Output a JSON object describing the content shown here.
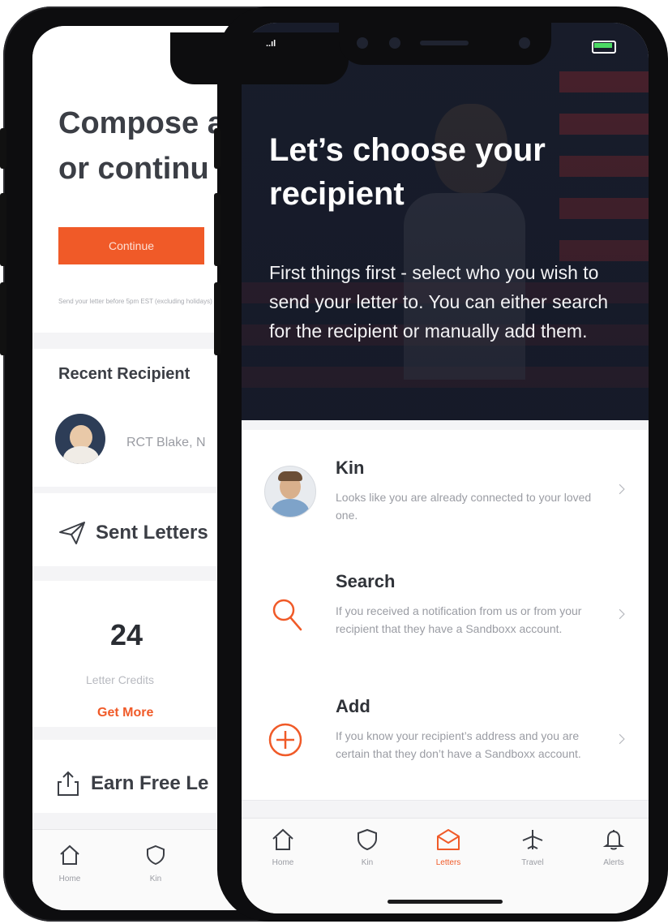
{
  "back_screen": {
    "compose_title_line1": "Compose a",
    "compose_title_line2": "or continu",
    "continue_label": "Continue",
    "note": "Send your letter before 5pm EST (excluding holidays)",
    "recent_recipients_title": "Recent Recipient",
    "recent_recipient_name": "RCT Blake, N",
    "sent_letters_label": "Sent Letters",
    "credits_count": "24",
    "credits_label": "Letter Credits",
    "get_more_label": "Get More",
    "earn_free_label": "Earn Free Le",
    "tabs": [
      {
        "label": "Home",
        "icon": "home-icon"
      },
      {
        "label": "Kin",
        "icon": "shield-icon"
      }
    ]
  },
  "front_screen": {
    "status": {
      "signal": "..ıl"
    },
    "hero": {
      "title": "Let’s choose your recipient",
      "subtitle": "First things first - select who you wish to send your letter to. You can either search for the recipient or manually add them."
    },
    "options": [
      {
        "title": "Kin",
        "description": "Looks like you are already connected to your loved one.",
        "icon": "avatar-icon"
      },
      {
        "title": "Search",
        "description": "If you received a notification from us or from your recipient that they have a Sandboxx account.",
        "icon": "search-icon"
      },
      {
        "title": "Add",
        "description": "If you know your recipient’s address and you are certain that they don’t have a Sandboxx account.",
        "icon": "plus-circle-icon"
      }
    ],
    "tabs": [
      {
        "label": "Home",
        "icon": "home-icon"
      },
      {
        "label": "Kin",
        "icon": "shield-icon"
      },
      {
        "label": "Letters",
        "icon": "envelope-icon",
        "active": true
      },
      {
        "label": "Travel",
        "icon": "plane-icon"
      },
      {
        "label": "Alerts",
        "icon": "bell-icon"
      }
    ]
  },
  "colors": {
    "accent": "#f05a28",
    "text_dark": "#3b3e45",
    "text_muted": "#9a9ca3",
    "background": "#f4f4f6"
  }
}
